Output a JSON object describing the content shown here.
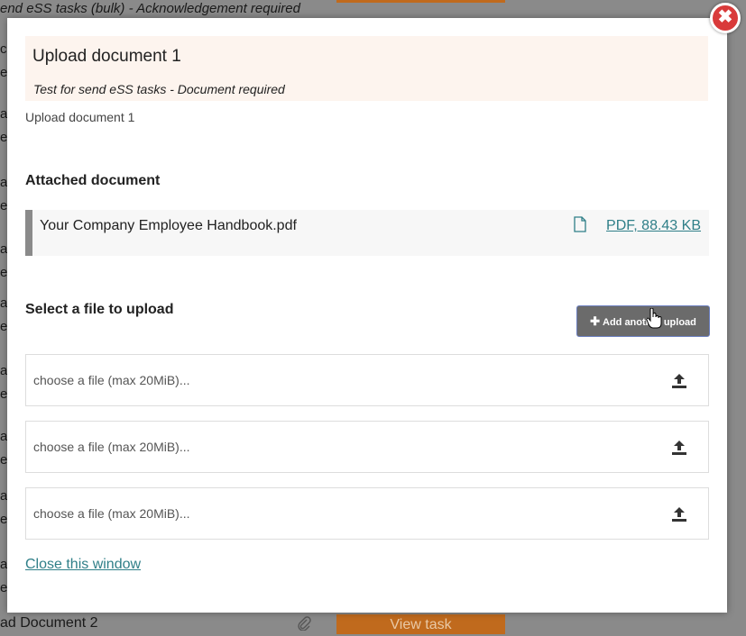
{
  "background": {
    "top_text": "end eSS tasks (bulk) - Acknowledgement required",
    "left_letters": [
      "c",
      "e",
      "a",
      "e",
      "a",
      "e",
      "a",
      "e",
      "a",
      "e",
      "a",
      "e",
      "a",
      "e",
      "a",
      "e",
      "a",
      "e"
    ],
    "bottom_text": "ad Document 2",
    "view_task_label": "View task"
  },
  "modal": {
    "close_icon_glyph": "✖",
    "header": {
      "title": "Upload document 1",
      "subtitle": "Test for send eSS tasks - Document required"
    },
    "description": "Upload document 1",
    "attached_heading": "Attached document",
    "attached": {
      "file_name": "Your Company Employee Handbook.pdf",
      "link_text": " PDF, 88.43 KB"
    },
    "select_heading": "Select a file to upload",
    "add_button_label": "Add another upload",
    "uploads": [
      {
        "placeholder": "choose a file (max 20MiB)..."
      },
      {
        "placeholder": "choose a file (max 20MiB)..."
      },
      {
        "placeholder": "choose a file (max 20MiB)..."
      }
    ],
    "close_link": "Close this window"
  }
}
